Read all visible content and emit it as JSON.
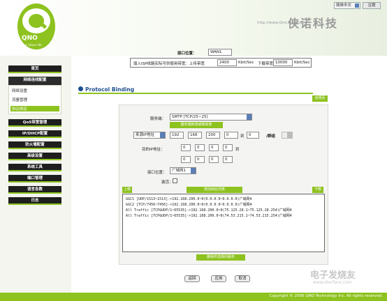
{
  "header": {
    "language": "简体中文",
    "logout_label": "注销",
    "site_url": "http://www.Qno.com.tw",
    "brand_cn": "侠诺科技",
    "logo_text": "QNO",
    "logo_tagline": "your future life"
  },
  "sidebar": {
    "items": [
      {
        "label": "首页"
      },
      {
        "label": "网络连线配置"
      },
      {
        "label": "QoS带宽管理"
      },
      {
        "label": "IP/DHCP配置"
      },
      {
        "label": "防火墙配置"
      },
      {
        "label": "高级设置"
      },
      {
        "label": "系统工具"
      },
      {
        "label": "端口管理"
      },
      {
        "label": "语言各数"
      },
      {
        "label": "日志"
      }
    ],
    "submenu": [
      "网络设置",
      "流量管理",
      "协议绑定"
    ]
  },
  "interface_row": {
    "label": "接口位置：",
    "value": "WAN1"
  },
  "bandwidth": {
    "label": "填入ISP线路实际可供使用带宽：上传带宽",
    "upload": "2400",
    "unit1": "Kbit/Sec",
    "download_label": "下载带宽",
    "download": "10000",
    "unit2": "Kbit/Sec"
  },
  "section": {
    "title": "Protocol Binding",
    "help_label": "说明页"
  },
  "form": {
    "service_label": "服务端：",
    "service_value": "SMTP [TCP/25~25]",
    "add_service_label": "服务端新增或移除表",
    "source_ip_select": "来源IP地址",
    "source_ip": [
      "192",
      "168",
      "200",
      "0"
    ],
    "to_label": "到",
    "source_ip_end": "0",
    "group_label": "/群组",
    "dest_ip_label": "目的IP地址：",
    "dest_ip": [
      "0",
      "0",
      "0",
      "0"
    ],
    "dest_ip_end": [
      "0",
      "0",
      "0",
      "0"
    ],
    "interface_label": "接口位置：",
    "interface_value": "广域网1",
    "enable_label": "激活："
  },
  "list": {
    "up_label": "上移",
    "add_label": "增加到此列表",
    "down_label": "下移",
    "rows": [
      "GGC1 [UDP/1513~1513]->192.168.200.0~0(0.0.0.0~0.0.0.0)广域网4",
      "GGC2 [TCP/7456~7456]->192.168.200.0~0(0.0.0.0~0.0.0.0)广域网4",
      "All Traffic [TCP&UDP/1~65535]->192.168.200.0~0(75.125.28.1~75.125.28.254)广域网4",
      "All Traffic [TCP&UDP/1~65535]->192.168.200.0~0(74.53.215.1~74.53.215.254)广域网4"
    ],
    "remove_label": "删除所选择的服务"
  },
  "buttons": {
    "back": "返回",
    "apply": "应用",
    "cancel": "取消"
  },
  "footer": {
    "copyright": "Copyright © 2006 QNO Technology Inc. All rights reserved."
  },
  "watermark": {
    "text": "电子发烧友",
    "url": "www.elecfans.com"
  },
  "colors": {
    "accent_green": "#8dc21f",
    "title_blue": "#1f4f8f",
    "nav_dark": "#1e1e1e"
  }
}
